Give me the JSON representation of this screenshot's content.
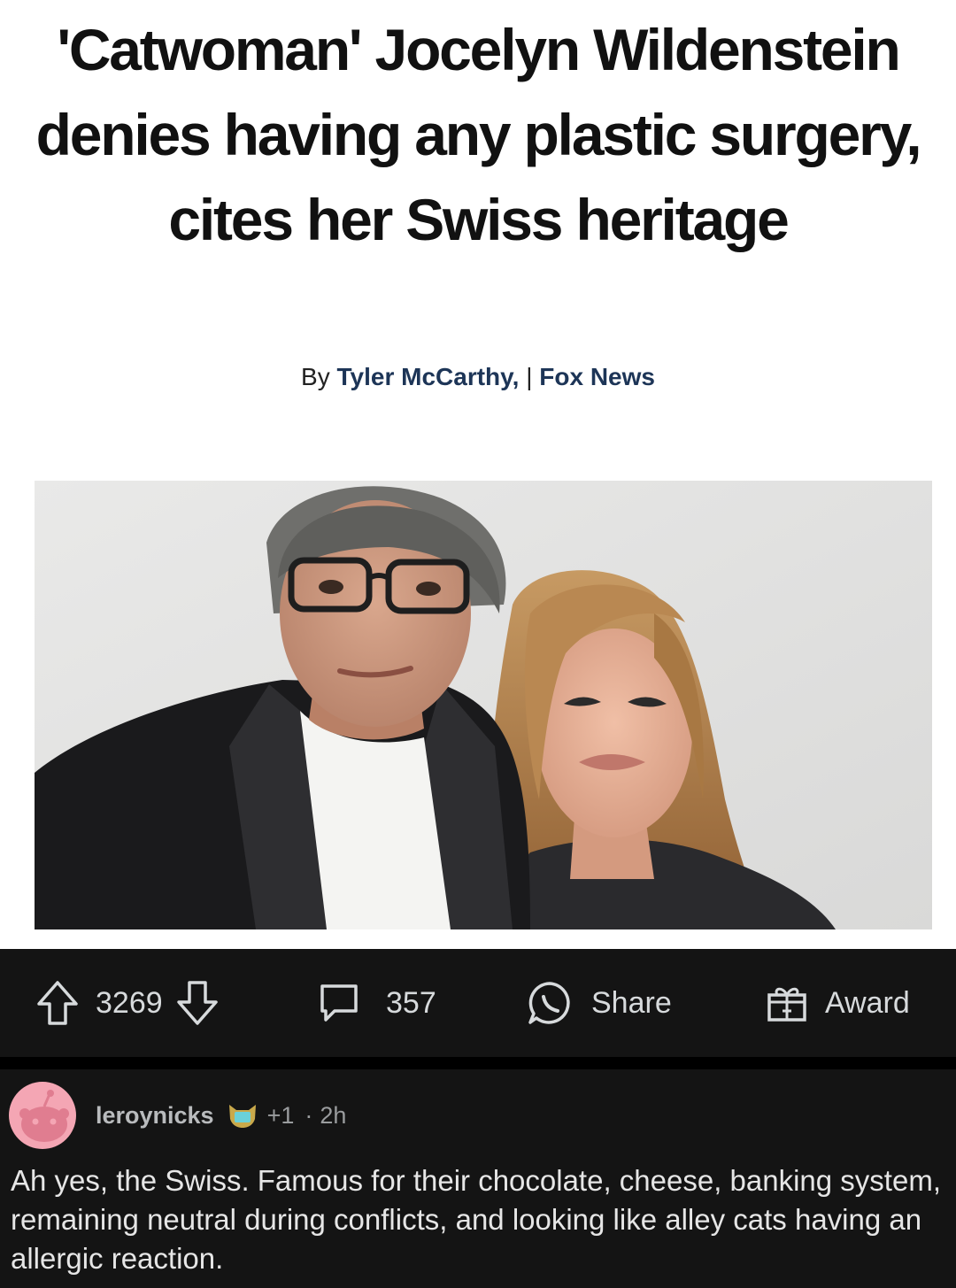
{
  "article": {
    "headline": "'Catwoman' Jocelyn Wildenstein denies having any plastic surgery, cites her Swiss heritage",
    "byline_prefix": "By ",
    "author": "Tyler McCarthy,",
    "separator": " | ",
    "outlet": "Fox News"
  },
  "post_actions": {
    "upvotes": "3269",
    "comments": "357",
    "share_label": "Share",
    "award_label": "Award"
  },
  "comment": {
    "username": "leroynicks",
    "karma_badge": "+1",
    "time_separator": "·",
    "age": "2h",
    "body": "Ah yes, the Swiss. Famous for their chocolate, cheese, banking system, remaining neutral during conflicts, and looking like alley cats having an allergic reaction."
  },
  "icons": {
    "upvote": "arrow-up-icon",
    "downvote": "arrow-down-icon",
    "comments": "speech-bubble-icon",
    "share": "share-icon",
    "award": "gift-icon",
    "avatar": "reddit-snoo-icon",
    "user_badge": "cat-badge-icon"
  },
  "colors": {
    "dark_bg": "#141414",
    "text_light": "#d7dadc",
    "byline_blue": "#1d3557",
    "avatar_pink": "#f4a6b4"
  }
}
